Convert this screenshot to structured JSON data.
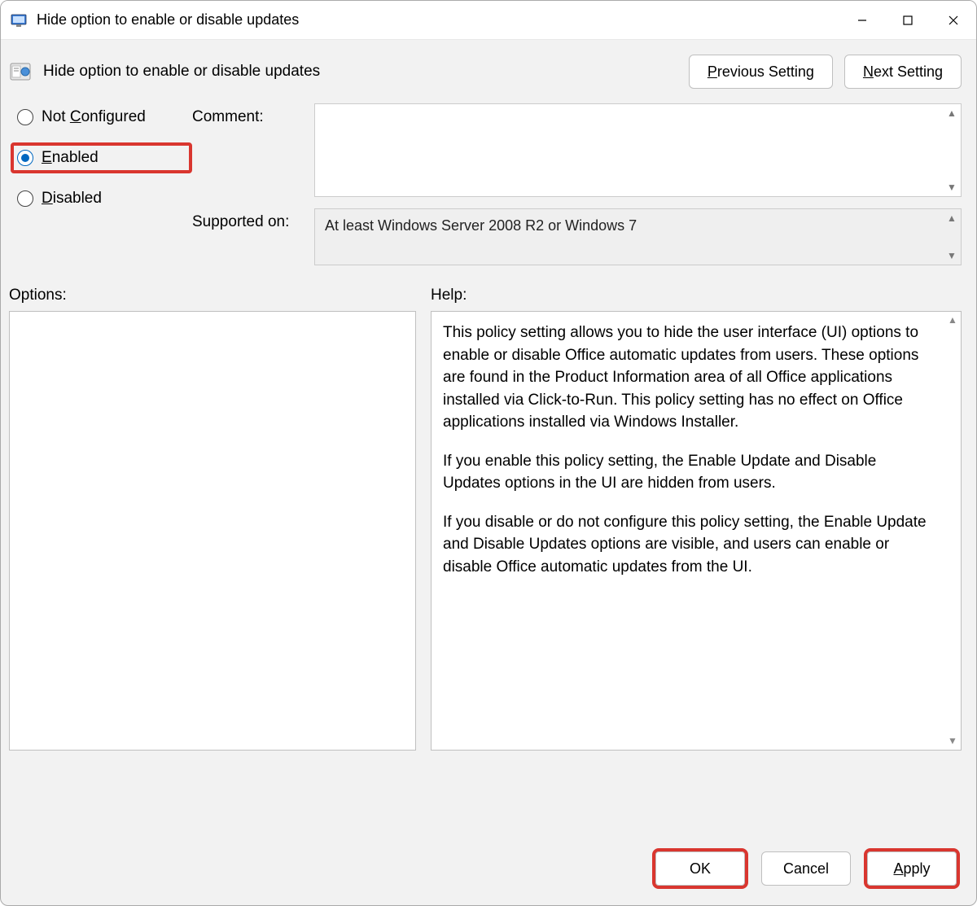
{
  "window": {
    "title": "Hide option to enable or disable updates"
  },
  "header": {
    "policy_title": "Hide option to enable or disable updates",
    "previous_label_pre": "P",
    "previous_label_rest": "revious Setting",
    "next_label_pre": "N",
    "next_label_rest": "ext Setting"
  },
  "radios": {
    "not_configured_pre": "Not ",
    "not_configured_accel": "C",
    "not_configured_rest": "onfigured",
    "enabled_accel": "E",
    "enabled_rest": "nabled",
    "disabled_accel": "D",
    "disabled_rest": "isabled",
    "selected": "enabled"
  },
  "fields": {
    "comment_label": "Comment:",
    "comment_value": "",
    "supported_label": "Supported on:",
    "supported_value": "At least Windows Server 2008 R2 or Windows 7"
  },
  "sections": {
    "options_label": "Options:",
    "help_label": "Help:"
  },
  "help": {
    "p1": "This policy setting allows you to hide the user interface (UI) options to enable or disable Office automatic updates from users. These options are found in the Product Information area of all Office applications installed via Click-to-Run. This policy setting has no effect on Office applications installed via Windows Installer.",
    "p2": "If you enable this policy setting, the Enable Update and Disable Updates options in the UI are hidden from users.",
    "p3": "If you disable or do not configure this policy setting, the Enable Update and Disable Updates options are visible, and users can enable or disable Office automatic updates from the UI."
  },
  "footer": {
    "ok": "OK",
    "cancel": "Cancel",
    "apply_accel": "A",
    "apply_rest": "pply"
  }
}
